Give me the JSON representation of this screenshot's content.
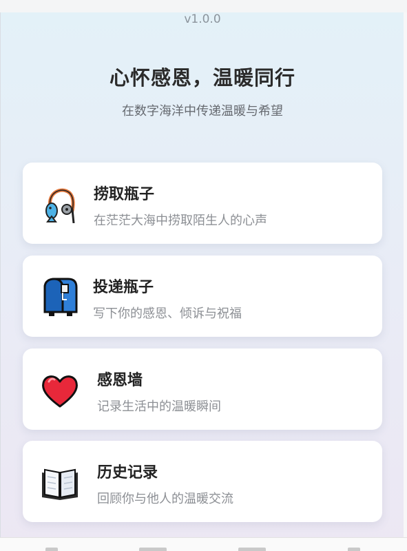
{
  "app": {
    "version": "v1.0.0"
  },
  "header": {
    "title": "心怀感恩，温暖同行",
    "subtitle": "在数字海洋中传递温暖与希望"
  },
  "cards": [
    {
      "title": "捞取瓶子",
      "desc": "在茫茫大海中捞取陌生人的心声",
      "icon": "fishing-pole-icon"
    },
    {
      "title": "投递瓶子",
      "desc": "写下你的感恩、倾诉与祝福",
      "icon": "mailbox-icon"
    },
    {
      "title": "感恩墙",
      "desc": "记录生活中的温暖瞬间",
      "icon": "heart-icon"
    },
    {
      "title": "历史记录",
      "desc": "回顾你与他人的温暖交流",
      "icon": "open-book-icon"
    }
  ],
  "colors": {
    "accent_heart": "#e8283a",
    "mailbox_blue": "#2f7fd8",
    "line_orange": "#e2763a"
  }
}
